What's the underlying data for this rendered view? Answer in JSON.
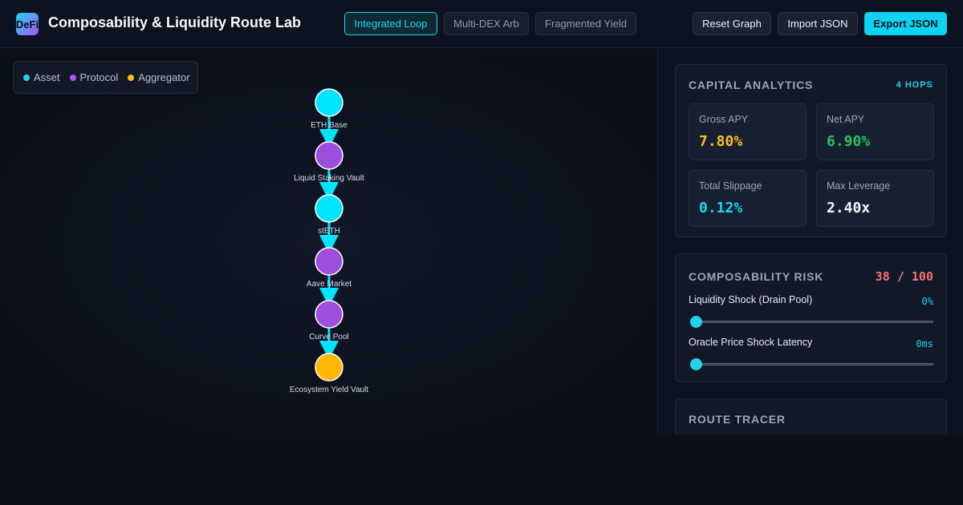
{
  "app": {
    "logo_text": "DeFi",
    "title": "Composability & Liquidity Route Lab"
  },
  "presets": [
    {
      "label": "Integrated Loop",
      "active": true
    },
    {
      "label": "Multi-DEX Arb",
      "active": false
    },
    {
      "label": "Fragmented Yield",
      "active": false
    }
  ],
  "toolbar": {
    "reset_label": "Reset Graph",
    "import_label": "Import JSON",
    "export_label": "Export JSON"
  },
  "legend": [
    {
      "label": "Asset",
      "color": "#22d3ee"
    },
    {
      "label": "Protocol",
      "color": "#a855f7"
    },
    {
      "label": "Aggregator",
      "color": "#fbbf24"
    }
  ],
  "graph": {
    "node_colors": {
      "asset": "#00e5ff",
      "protocol": "#9d4edd",
      "aggregator": "#ffb703"
    },
    "edge_color": "#00e5ff",
    "nodes": [
      {
        "label": "ETH Base",
        "type": "asset"
      },
      {
        "label": "Liquid Staking Vault",
        "type": "protocol"
      },
      {
        "label": "stETH",
        "type": "asset"
      },
      {
        "label": "Aave Market",
        "type": "protocol"
      },
      {
        "label": "Curve Pool",
        "type": "protocol"
      },
      {
        "label": "Ecosystem Yield Vault",
        "type": "aggregator"
      }
    ]
  },
  "analytics": {
    "title": "CAPITAL ANALYTICS",
    "hops": "4 HOPS",
    "metrics": [
      {
        "label": "Gross APY",
        "value": "7.80%",
        "color": "#fbbf24"
      },
      {
        "label": "Net APY",
        "value": "6.90%",
        "color": "#22c55e"
      },
      {
        "label": "Total Slippage",
        "value": "0.12%",
        "color": "#22d3ee"
      },
      {
        "label": "Max Leverage",
        "value": "2.40x",
        "color": "#f3f6fb"
      }
    ]
  },
  "risk": {
    "title": "COMPOSABILITY RISK",
    "score": "38 / 100",
    "sliders": [
      {
        "label": "Liquidity Shock (Drain Pool)",
        "value": "0%",
        "level": 0
      },
      {
        "label": "Oracle Price Shock Latency",
        "value": "0ms",
        "level": 0
      }
    ]
  },
  "tracer": {
    "title": "ROUTE TRACER"
  }
}
